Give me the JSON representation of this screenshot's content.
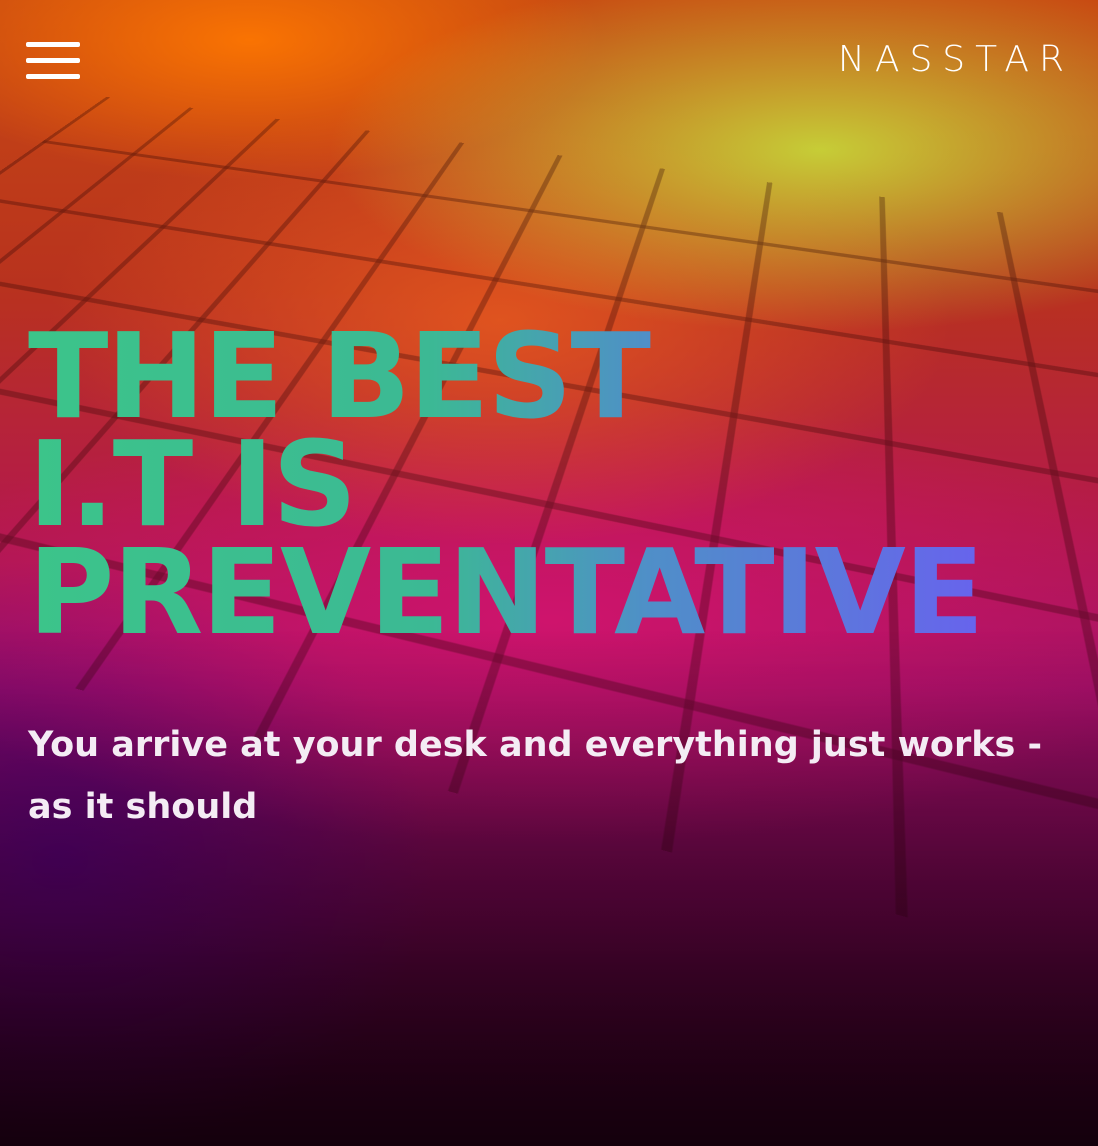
{
  "header": {
    "menu_icon": "hamburger-menu-icon",
    "logo_text": "NASSTAR"
  },
  "hero": {
    "headline_lines": [
      "THE BEST",
      "I.T IS",
      "PREVENTATIVE"
    ],
    "subheadline": "You arrive at your desk and everything just works - as it should"
  },
  "colors": {
    "headline_gradient_start": "#3cc48a",
    "headline_gradient_end": "#6b5df2",
    "text_light": "#ffffff"
  }
}
